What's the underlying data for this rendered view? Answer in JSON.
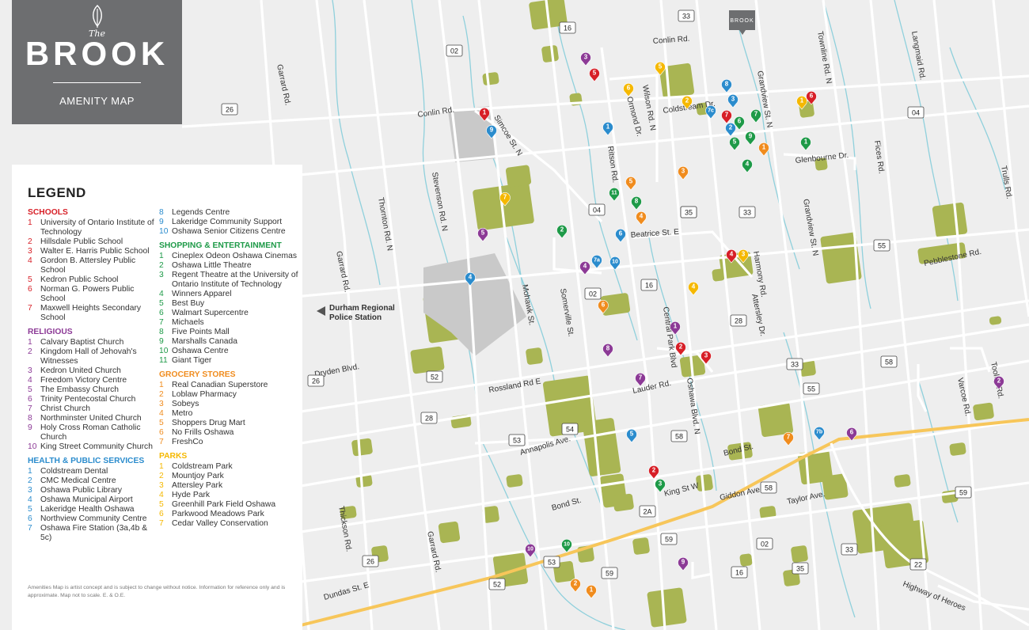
{
  "brand": {
    "the": "The",
    "name": "BROOK",
    "subtitle": "AMENITY MAP"
  },
  "site_marker": "BROOK",
  "legend": {
    "title": "LEGEND",
    "note": "Amenities Map is artist concept and is subject to change without notice. Information for reference only and is approximate. Map not to scale. E. & O.E.",
    "column1": [
      {
        "title": "SCHOOLS",
        "color": "#d71f27",
        "items": [
          {
            "num": "1",
            "text": "University of Ontario Institute of Technology"
          },
          {
            "num": "2",
            "text": "Hillsdale Public School"
          },
          {
            "num": "3",
            "text": "Walter E. Harris Public School"
          },
          {
            "num": "4",
            "text": "Gordon B. Attersley Public School"
          },
          {
            "num": "5",
            "text": "Kedron Public School"
          },
          {
            "num": "6",
            "text": "Norman G. Powers Public School"
          },
          {
            "num": "7",
            "text": "Maxwell Heights Secondary School"
          }
        ]
      },
      {
        "title": "RELIGIOUS",
        "color": "#8c3a96",
        "items": [
          {
            "num": "1",
            "text": "Calvary Baptist Church"
          },
          {
            "num": "2",
            "text": "Kingdom Hall of Jehovah's Witnesses"
          },
          {
            "num": "3",
            "text": "Kedron United Church"
          },
          {
            "num": "4",
            "text": "Freedom Victory Centre"
          },
          {
            "num": "5",
            "text": "The Embassy Church"
          },
          {
            "num": "6",
            "text": "Trinity Pentecostal Church"
          },
          {
            "num": "7",
            "text": "Christ Church"
          },
          {
            "num": "8",
            "text": "Northminster United Church"
          },
          {
            "num": "9",
            "text": "Holy Cross Roman Catholic Church"
          },
          {
            "num": "10",
            "text": "King Street Community Church"
          }
        ]
      },
      {
        "title": "HEALTH & PUBLIC SERVICES",
        "color": "#2b8ccd",
        "items": [
          {
            "num": "1",
            "text": "Coldstream Dental"
          },
          {
            "num": "2",
            "text": "CMC Medical Centre"
          },
          {
            "num": "3",
            "text": "Oshawa Public Library"
          },
          {
            "num": "4",
            "text": "Oshawa Municipal Airport"
          },
          {
            "num": "5",
            "text": "Lakeridge Health Oshawa"
          },
          {
            "num": "6",
            "text": "Northview Community Centre"
          },
          {
            "num": "7",
            "text": "Oshawa Fire Station (3a,4b & 5c)"
          }
        ]
      }
    ],
    "column2": [
      {
        "title": "",
        "color": "#2b8ccd",
        "items": [
          {
            "num": "8",
            "text": "Legends Centre"
          },
          {
            "num": "9",
            "text": "Lakeridge Community Support"
          },
          {
            "num": "10",
            "text": "Oshawa Senior Citizens Centre"
          }
        ]
      },
      {
        "title": "SHOPPING & ENTERTAINMENT",
        "color": "#1e9a48",
        "items": [
          {
            "num": "1",
            "text": "Cineplex Odeon Oshawa Cinemas"
          },
          {
            "num": "2",
            "text": "Oshawa Little Theatre"
          },
          {
            "num": "3",
            "text": "Regent Theatre at the University of Ontario Institute of Technology"
          },
          {
            "num": "4",
            "text": "Winners Apparel"
          },
          {
            "num": "5",
            "text": "Best Buy"
          },
          {
            "num": "6",
            "text": "Walmart Supercentre"
          },
          {
            "num": "7",
            "text": "Michaels"
          },
          {
            "num": "8",
            "text": "Five Points Mall"
          },
          {
            "num": "9",
            "text": "Marshalls Canada"
          },
          {
            "num": "10",
            "text": "Oshawa Centre"
          },
          {
            "num": "11",
            "text": "Giant Tiger"
          }
        ]
      },
      {
        "title": "GROCERY STORES",
        "color": "#f08c1e",
        "items": [
          {
            "num": "1",
            "text": "Real Canadian Superstore"
          },
          {
            "num": "2",
            "text": "Loblaw Pharmacy"
          },
          {
            "num": "3",
            "text": "Sobeys"
          },
          {
            "num": "4",
            "text": "Metro"
          },
          {
            "num": "5",
            "text": "Shoppers Drug Mart"
          },
          {
            "num": "6",
            "text": "No Frills Oshawa"
          },
          {
            "num": "7",
            "text": "FreshCo"
          }
        ]
      },
      {
        "title": "PARKS",
        "color": "#f5b800",
        "items": [
          {
            "num": "1",
            "text": "Coldstream Park"
          },
          {
            "num": "2",
            "text": "Mountjoy Park"
          },
          {
            "num": "3",
            "text": "Attersley Park"
          },
          {
            "num": "4",
            "text": "Hyde Park"
          },
          {
            "num": "5",
            "text": "Greenhill Park Field Oshawa"
          },
          {
            "num": "6",
            "text": "Parkwood Meadows Park"
          },
          {
            "num": "7",
            "text": "Cedar Valley Conservation"
          }
        ]
      }
    ]
  },
  "streets": {
    "conlin_rd_n": "Conlin Rd.",
    "conlin_rd_w": "Conlin Rd.",
    "garrard_rd_n": "Garrard Rd.",
    "garrard_rd_m": "Garrard Rd.",
    "garrard_rd_s": "Garrard Rd.",
    "thornton_rd": "Thornton Rd. N",
    "stevenson_rd": "Stevenson Rd. N",
    "simcoe_st": "Simcoe St. N",
    "ritson_rd": "Ritson Rd.",
    "wilson_rd": "Wilson Rd. N",
    "ormond_dr": "Ormond Dr.",
    "coldstream_dr": "Coldstream Dr.",
    "grandview_n": "Grandview St. N",
    "grandview_s": "Grandview St. N",
    "townline_rd": "Townline Rd. N",
    "langmaid_rd": "Langmaid Rd.",
    "fices_rd": "Fices Rd.",
    "trulls_rd": "Trulls Rd.",
    "glenbourne_dr": "Glenbourne Dr.",
    "harmony_rd": "Harmony Rd.",
    "attersley_dr": "Attersley Dr.",
    "beatrice_st": "Beatrice St. E",
    "pebblestone_rd": "Pebblestone Rd.",
    "mohawk_st": "Mohawk St.",
    "somerville_st": "Somerville St.",
    "central_park": "Central Park Blvd",
    "oshawa_blvd": "Oshawa Blvd. N",
    "dryden_blvd": "Dryden Blvd.",
    "rossland_rd": "Rossland Rd E",
    "lauder_rd": "Lauder Rd.",
    "annapolis_ave": "Annapolis Ave.",
    "bond_st_e": "Bond St.",
    "bond_st_w": "Bond St.",
    "king_st": "King St W",
    "giddon_ave": "Giddon Ave.",
    "taylor_ave": "Taylor Ave.",
    "thickson_rd": "Thickson Rd.",
    "dundas_st": "Dundas St. E",
    "highway_heroes": "Highway of Heroes",
    "tooley_rd": "Tooley Rd.",
    "varcoe_rd": "Varcoe Rd.",
    "police": "Durham Regional Police Station"
  },
  "route_shields": [
    "33",
    "16",
    "02",
    "26",
    "04",
    "35",
    "33",
    "04",
    "55",
    "35",
    "16",
    "02",
    "28",
    "33",
    "58",
    "26",
    "52",
    "28",
    "53",
    "54",
    "58",
    "55",
    "58",
    "2A",
    "59",
    "02",
    "59",
    "16",
    "35",
    "33",
    "22",
    "26",
    "53",
    "52",
    "59"
  ],
  "pins": [
    {
      "cat": "school",
      "num": "1"
    },
    {
      "cat": "school",
      "num": "5"
    },
    {
      "cat": "school",
      "num": "7"
    },
    {
      "cat": "school",
      "num": "6"
    },
    {
      "cat": "school",
      "num": "4"
    },
    {
      "cat": "school",
      "num": "2"
    },
    {
      "cat": "school",
      "num": "3"
    },
    {
      "cat": "school",
      "num": "2"
    },
    {
      "cat": "religious",
      "num": "3"
    },
    {
      "cat": "religious",
      "num": "5"
    },
    {
      "cat": "religious",
      "num": "4"
    },
    {
      "cat": "religious",
      "num": "1"
    },
    {
      "cat": "religious",
      "num": "8"
    },
    {
      "cat": "religious",
      "num": "7"
    },
    {
      "cat": "religious",
      "num": "6"
    },
    {
      "cat": "religious",
      "num": "2"
    },
    {
      "cat": "religious",
      "num": "10"
    },
    {
      "cat": "religious",
      "num": "9"
    },
    {
      "cat": "health",
      "num": "9"
    },
    {
      "cat": "health",
      "num": "1"
    },
    {
      "cat": "health",
      "num": "8"
    },
    {
      "cat": "health",
      "num": "3"
    },
    {
      "cat": "health",
      "num": "7c"
    },
    {
      "cat": "health",
      "num": "2"
    },
    {
      "cat": "health",
      "num": "6"
    },
    {
      "cat": "health",
      "num": "7a"
    },
    {
      "cat": "health",
      "num": "10"
    },
    {
      "cat": "health",
      "num": "4"
    },
    {
      "cat": "health",
      "num": "5"
    },
    {
      "cat": "health",
      "num": "7b"
    },
    {
      "cat": "shopping",
      "num": "6"
    },
    {
      "cat": "shopping",
      "num": "7"
    },
    {
      "cat": "shopping",
      "num": "9"
    },
    {
      "cat": "shopping",
      "num": "5"
    },
    {
      "cat": "shopping",
      "num": "4"
    },
    {
      "cat": "shopping",
      "num": "1"
    },
    {
      "cat": "shopping",
      "num": "11"
    },
    {
      "cat": "shopping",
      "num": "8"
    },
    {
      "cat": "shopping",
      "num": "2"
    },
    {
      "cat": "shopping",
      "num": "3"
    },
    {
      "cat": "shopping",
      "num": "10"
    },
    {
      "cat": "grocery",
      "num": "1"
    },
    {
      "cat": "grocery",
      "num": "3"
    },
    {
      "cat": "grocery",
      "num": "5"
    },
    {
      "cat": "grocery",
      "num": "4"
    },
    {
      "cat": "grocery",
      "num": "6"
    },
    {
      "cat": "grocery",
      "num": "7"
    },
    {
      "cat": "grocery",
      "num": "2"
    },
    {
      "cat": "grocery",
      "num": "1"
    },
    {
      "cat": "park",
      "num": "5"
    },
    {
      "cat": "park",
      "num": "6"
    },
    {
      "cat": "park",
      "num": "2"
    },
    {
      "cat": "park",
      "num": "1"
    },
    {
      "cat": "park",
      "num": "3"
    },
    {
      "cat": "park",
      "num": "4"
    },
    {
      "cat": "park",
      "num": "7"
    }
  ],
  "colors": {
    "school": "#d71f27",
    "religious": "#8c3a96",
    "health": "#2b8ccd",
    "shopping": "#1e9a48",
    "grocery": "#f08c1e",
    "park": "#f5b800",
    "greenspace": "#a9b553",
    "road": "#ffffff",
    "highway": "#f7c65a",
    "water": "#8fd0dc",
    "built": "#c9c9c9",
    "panel": "#6d6e70"
  }
}
